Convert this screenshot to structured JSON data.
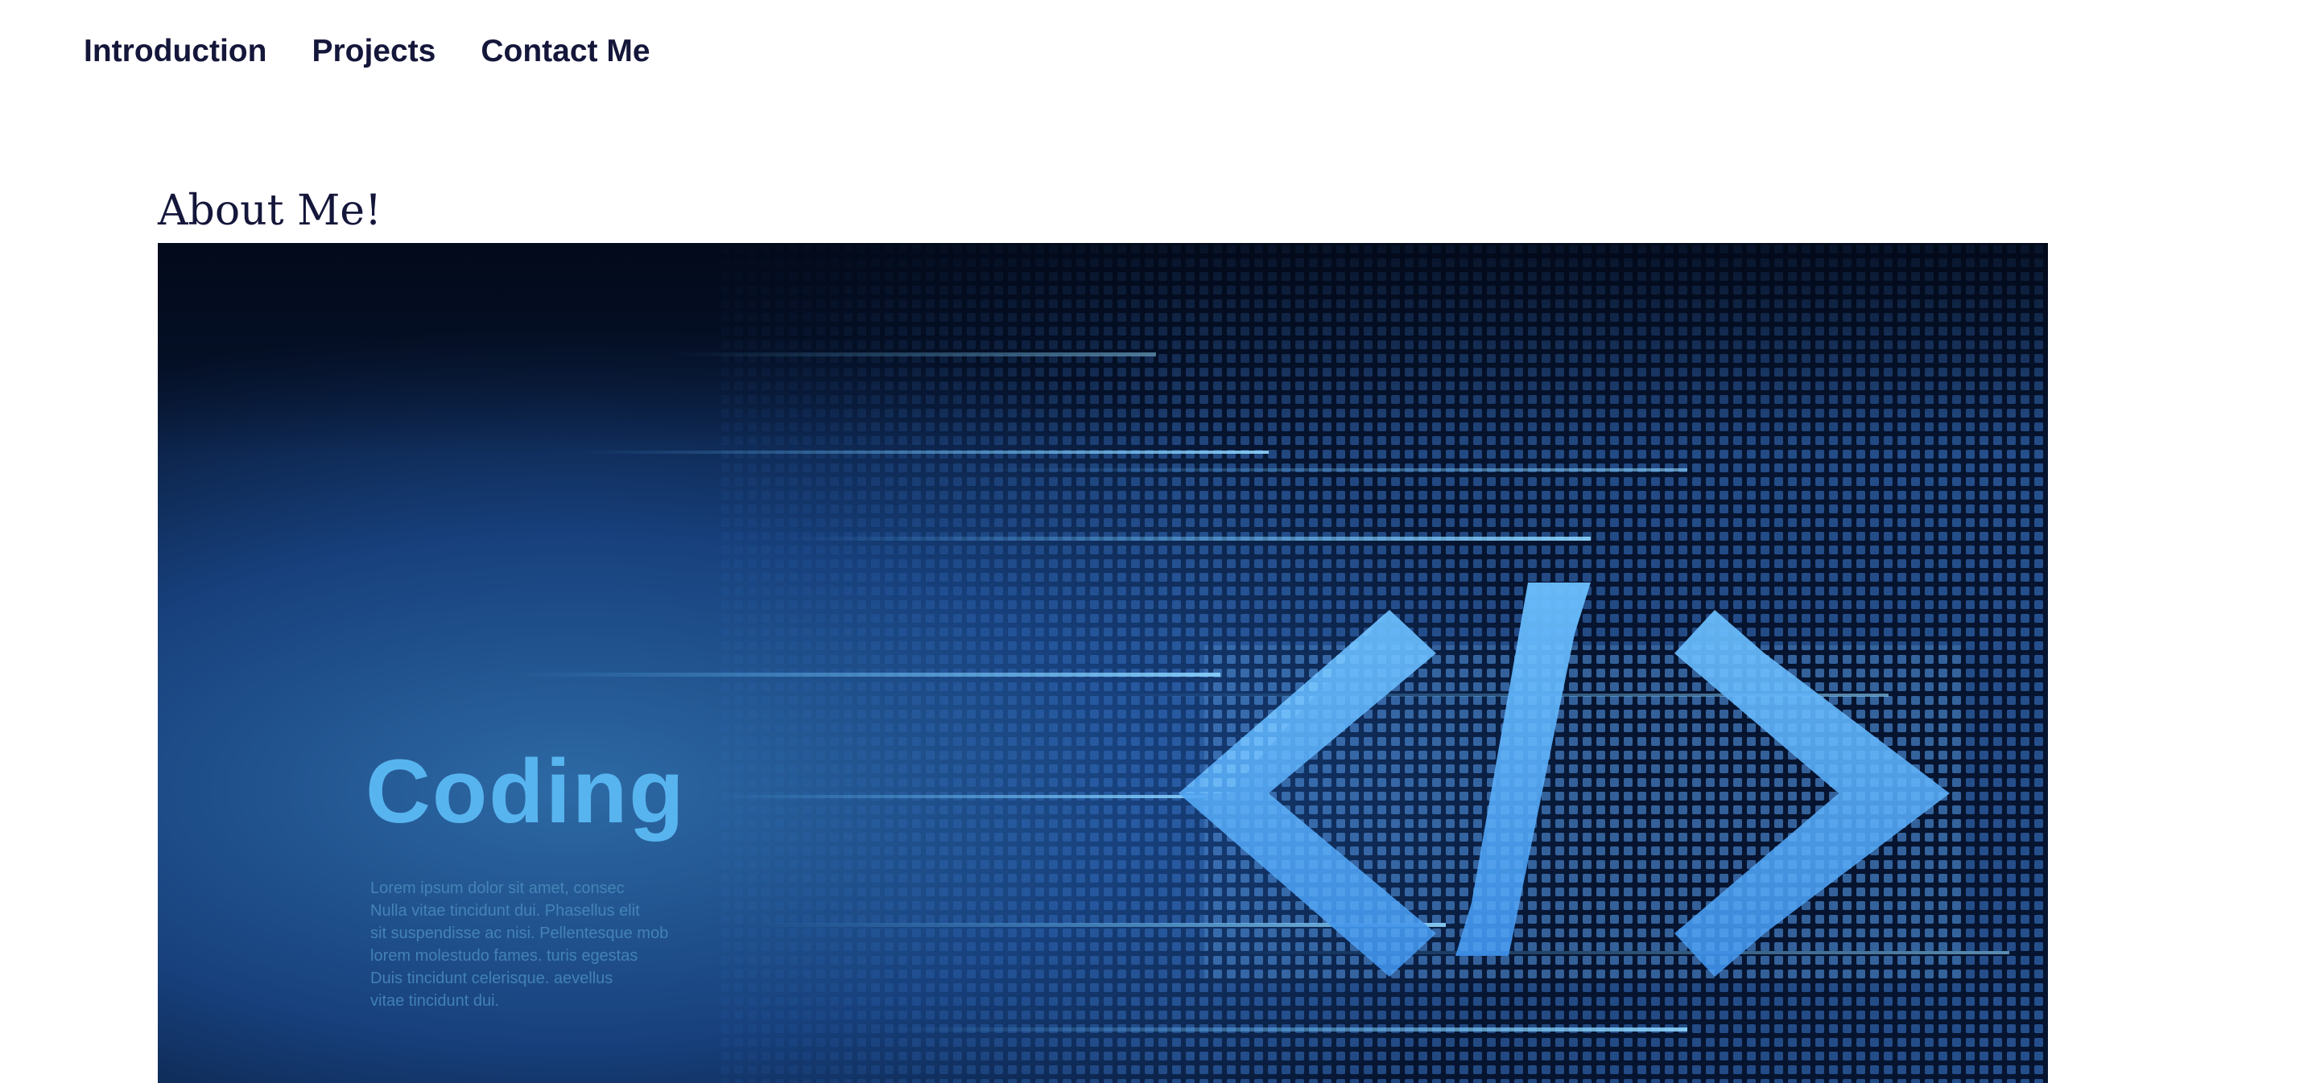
{
  "nav": {
    "items": [
      {
        "label": "Introduction"
      },
      {
        "label": "Projects"
      },
      {
        "label": "Contact Me"
      }
    ]
  },
  "about": {
    "title": "About Me!"
  },
  "hero": {
    "word": "Coding",
    "code_symbol": "</>",
    "lines": [
      "Lorem ipsum dolor sit amet, consec",
      "Nulla vitae tincidunt dui. Phasellus elit",
      "sit suspendisse ac nisi. Pellentesque mob",
      "lorem molestudo fames. turis egestas",
      "Duis tincidunt celerisque. aevellus",
      "vitae tincidunt dui."
    ]
  },
  "colors": {
    "nav_text": "#14163a",
    "heading_text": "#14163a",
    "hero_dark": "#06122e",
    "hero_accent": "#58b4ee"
  }
}
